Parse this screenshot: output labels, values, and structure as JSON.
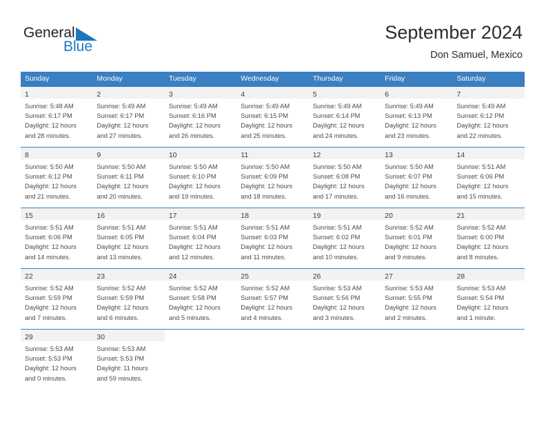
{
  "brand": {
    "name_part1": "General",
    "name_part2": "Blue",
    "flag_color": "#1b77c0"
  },
  "header": {
    "title": "September 2024",
    "subtitle": "Don Samuel, Mexico"
  },
  "theme": {
    "header_blue": "#3a7fc1",
    "daynum_band": "#f2f2f2",
    "text": "#4a4a4a"
  },
  "weekdays": [
    "Sunday",
    "Monday",
    "Tuesday",
    "Wednesday",
    "Thursday",
    "Friday",
    "Saturday"
  ],
  "weeks": [
    [
      {
        "day": "1",
        "sunrise": "Sunrise: 5:48 AM",
        "sunset": "Sunset: 6:17 PM",
        "daylight1": "Daylight: 12 hours",
        "daylight2": "and 28 minutes."
      },
      {
        "day": "2",
        "sunrise": "Sunrise: 5:49 AM",
        "sunset": "Sunset: 6:17 PM",
        "daylight1": "Daylight: 12 hours",
        "daylight2": "and 27 minutes."
      },
      {
        "day": "3",
        "sunrise": "Sunrise: 5:49 AM",
        "sunset": "Sunset: 6:16 PM",
        "daylight1": "Daylight: 12 hours",
        "daylight2": "and 26 minutes."
      },
      {
        "day": "4",
        "sunrise": "Sunrise: 5:49 AM",
        "sunset": "Sunset: 6:15 PM",
        "daylight1": "Daylight: 12 hours",
        "daylight2": "and 25 minutes."
      },
      {
        "day": "5",
        "sunrise": "Sunrise: 5:49 AM",
        "sunset": "Sunset: 6:14 PM",
        "daylight1": "Daylight: 12 hours",
        "daylight2": "and 24 minutes."
      },
      {
        "day": "6",
        "sunrise": "Sunrise: 5:49 AM",
        "sunset": "Sunset: 6:13 PM",
        "daylight1": "Daylight: 12 hours",
        "daylight2": "and 23 minutes."
      },
      {
        "day": "7",
        "sunrise": "Sunrise: 5:49 AM",
        "sunset": "Sunset: 6:12 PM",
        "daylight1": "Daylight: 12 hours",
        "daylight2": "and 22 minutes."
      }
    ],
    [
      {
        "day": "8",
        "sunrise": "Sunrise: 5:50 AM",
        "sunset": "Sunset: 6:12 PM",
        "daylight1": "Daylight: 12 hours",
        "daylight2": "and 21 minutes."
      },
      {
        "day": "9",
        "sunrise": "Sunrise: 5:50 AM",
        "sunset": "Sunset: 6:11 PM",
        "daylight1": "Daylight: 12 hours",
        "daylight2": "and 20 minutes."
      },
      {
        "day": "10",
        "sunrise": "Sunrise: 5:50 AM",
        "sunset": "Sunset: 6:10 PM",
        "daylight1": "Daylight: 12 hours",
        "daylight2": "and 19 minutes."
      },
      {
        "day": "11",
        "sunrise": "Sunrise: 5:50 AM",
        "sunset": "Sunset: 6:09 PM",
        "daylight1": "Daylight: 12 hours",
        "daylight2": "and 18 minutes."
      },
      {
        "day": "12",
        "sunrise": "Sunrise: 5:50 AM",
        "sunset": "Sunset: 6:08 PM",
        "daylight1": "Daylight: 12 hours",
        "daylight2": "and 17 minutes."
      },
      {
        "day": "13",
        "sunrise": "Sunrise: 5:50 AM",
        "sunset": "Sunset: 6:07 PM",
        "daylight1": "Daylight: 12 hours",
        "daylight2": "and 16 minutes."
      },
      {
        "day": "14",
        "sunrise": "Sunrise: 5:51 AM",
        "sunset": "Sunset: 6:06 PM",
        "daylight1": "Daylight: 12 hours",
        "daylight2": "and 15 minutes."
      }
    ],
    [
      {
        "day": "15",
        "sunrise": "Sunrise: 5:51 AM",
        "sunset": "Sunset: 6:06 PM",
        "daylight1": "Daylight: 12 hours",
        "daylight2": "and 14 minutes."
      },
      {
        "day": "16",
        "sunrise": "Sunrise: 5:51 AM",
        "sunset": "Sunset: 6:05 PM",
        "daylight1": "Daylight: 12 hours",
        "daylight2": "and 13 minutes."
      },
      {
        "day": "17",
        "sunrise": "Sunrise: 5:51 AM",
        "sunset": "Sunset: 6:04 PM",
        "daylight1": "Daylight: 12 hours",
        "daylight2": "and 12 minutes."
      },
      {
        "day": "18",
        "sunrise": "Sunrise: 5:51 AM",
        "sunset": "Sunset: 6:03 PM",
        "daylight1": "Daylight: 12 hours",
        "daylight2": "and 11 minutes."
      },
      {
        "day": "19",
        "sunrise": "Sunrise: 5:51 AM",
        "sunset": "Sunset: 6:02 PM",
        "daylight1": "Daylight: 12 hours",
        "daylight2": "and 10 minutes."
      },
      {
        "day": "20",
        "sunrise": "Sunrise: 5:52 AM",
        "sunset": "Sunset: 6:01 PM",
        "daylight1": "Daylight: 12 hours",
        "daylight2": "and 9 minutes."
      },
      {
        "day": "21",
        "sunrise": "Sunrise: 5:52 AM",
        "sunset": "Sunset: 6:00 PM",
        "daylight1": "Daylight: 12 hours",
        "daylight2": "and 8 minutes."
      }
    ],
    [
      {
        "day": "22",
        "sunrise": "Sunrise: 5:52 AM",
        "sunset": "Sunset: 5:59 PM",
        "daylight1": "Daylight: 12 hours",
        "daylight2": "and 7 minutes."
      },
      {
        "day": "23",
        "sunrise": "Sunrise: 5:52 AM",
        "sunset": "Sunset: 5:59 PM",
        "daylight1": "Daylight: 12 hours",
        "daylight2": "and 6 minutes."
      },
      {
        "day": "24",
        "sunrise": "Sunrise: 5:52 AM",
        "sunset": "Sunset: 5:58 PM",
        "daylight1": "Daylight: 12 hours",
        "daylight2": "and 5 minutes."
      },
      {
        "day": "25",
        "sunrise": "Sunrise: 5:52 AM",
        "sunset": "Sunset: 5:57 PM",
        "daylight1": "Daylight: 12 hours",
        "daylight2": "and 4 minutes."
      },
      {
        "day": "26",
        "sunrise": "Sunrise: 5:53 AM",
        "sunset": "Sunset: 5:56 PM",
        "daylight1": "Daylight: 12 hours",
        "daylight2": "and 3 minutes."
      },
      {
        "day": "27",
        "sunrise": "Sunrise: 5:53 AM",
        "sunset": "Sunset: 5:55 PM",
        "daylight1": "Daylight: 12 hours",
        "daylight2": "and 2 minutes."
      },
      {
        "day": "28",
        "sunrise": "Sunrise: 5:53 AM",
        "sunset": "Sunset: 5:54 PM",
        "daylight1": "Daylight: 12 hours",
        "daylight2": "and 1 minute."
      }
    ],
    [
      {
        "day": "29",
        "sunrise": "Sunrise: 5:53 AM",
        "sunset": "Sunset: 5:53 PM",
        "daylight1": "Daylight: 12 hours",
        "daylight2": "and 0 minutes."
      },
      {
        "day": "30",
        "sunrise": "Sunrise: 5:53 AM",
        "sunset": "Sunset: 5:53 PM",
        "daylight1": "Daylight: 11 hours",
        "daylight2": "and 59 minutes."
      },
      {
        "day": "",
        "sunrise": "",
        "sunset": "",
        "daylight1": "",
        "daylight2": ""
      },
      {
        "day": "",
        "sunrise": "",
        "sunset": "",
        "daylight1": "",
        "daylight2": ""
      },
      {
        "day": "",
        "sunrise": "",
        "sunset": "",
        "daylight1": "",
        "daylight2": ""
      },
      {
        "day": "",
        "sunrise": "",
        "sunset": "",
        "daylight1": "",
        "daylight2": ""
      },
      {
        "day": "",
        "sunrise": "",
        "sunset": "",
        "daylight1": "",
        "daylight2": ""
      }
    ]
  ]
}
